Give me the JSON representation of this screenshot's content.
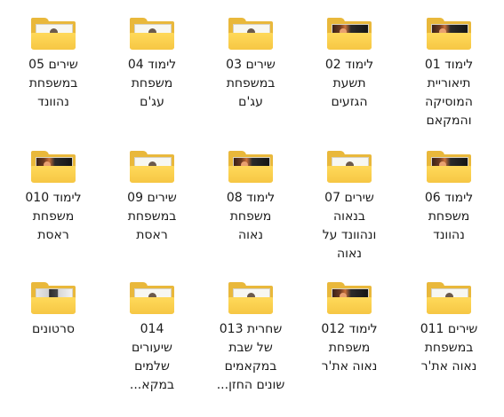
{
  "folders": [
    {
      "lines": [
        "לימוד 01",
        "תיאוריית",
        "המוסיקה",
        "והמקאם"
      ],
      "thumb": "thumb"
    },
    {
      "lines": [
        "לימוד 02",
        "תשעת",
        "הגזעים"
      ],
      "thumb": "thumb"
    },
    {
      "lines": [
        "שירים 03",
        "במשפחת",
        "עג'ם"
      ],
      "thumb": "plain"
    },
    {
      "lines": [
        "לימוד 04",
        "משפחת",
        "עג'ם"
      ],
      "thumb": "plain"
    },
    {
      "lines": [
        "שירים 05",
        "במשפחת",
        "נהוונד"
      ],
      "thumb": "plain"
    },
    {
      "lines": [
        "לימוד 06",
        "משפחת",
        "נהוונד"
      ],
      "thumb": "thumb"
    },
    {
      "lines": [
        "שירים 07",
        "בנאוה",
        "ונהוונד על",
        "נאוה"
      ],
      "thumb": "plain"
    },
    {
      "lines": [
        "לימוד 08",
        "משפחת",
        "נאוה"
      ],
      "thumb": "thumb"
    },
    {
      "lines": [
        "שירים 09",
        "במשפחת",
        "ראסת"
      ],
      "thumb": "plain"
    },
    {
      "lines": [
        "לימוד 010",
        "משפחת",
        "ראסת"
      ],
      "thumb": "thumb"
    },
    {
      "lines": [
        "שירים 011",
        "במשפחת",
        "נאוה את'ר"
      ],
      "thumb": "plain"
    },
    {
      "lines": [
        "לימוד 012",
        "משפחת",
        "נאוה את'ר"
      ],
      "thumb": "thumb"
    },
    {
      "lines": [
        "שחרית 013",
        "של שבת",
        "במקאמים",
        "שונים החזן..."
      ],
      "thumb": "plain"
    },
    {
      "lines": [
        "014",
        "שיעורים",
        "שלמים",
        "במקא..."
      ],
      "thumb": "plain"
    },
    {
      "lines": [
        "סרטונים"
      ],
      "thumb": "video"
    }
  ]
}
